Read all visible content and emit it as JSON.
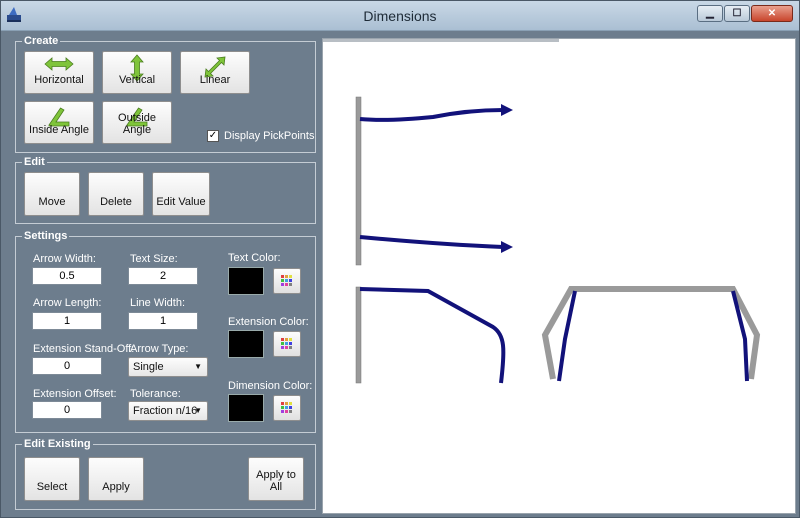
{
  "window": {
    "title": "Dimensions",
    "controls": {
      "minimize": "▁",
      "maximize": "☐",
      "close": "✕"
    }
  },
  "create": {
    "legend": "Create",
    "horizontal": "Horizontal",
    "vertical": "Vertical",
    "linear": "Linear",
    "inside_angle": "Inside Angle",
    "outside_angle": "Outside Angle",
    "display_pickpoints": "Display PickPoints",
    "display_pickpoints_checked": true
  },
  "edit": {
    "legend": "Edit",
    "move": "Move",
    "delete": "Delete",
    "edit_value": "Edit Value"
  },
  "settings": {
    "legend": "Settings",
    "arrow_width_label": "Arrow Width:",
    "arrow_width": "0.5",
    "text_size_label": "Text Size:",
    "text_size": "2",
    "arrow_length_label": "Arrow Length:",
    "arrow_length": "1",
    "line_width_label": "Line Width:",
    "line_width": "1",
    "standoff_label": "Extension Stand-Off:",
    "standoff": "0",
    "arrow_type_label": "Arrow Type:",
    "arrow_type": "Single",
    "offset_label": "Extension Offset:",
    "offset": "0",
    "tolerance_label": "Tolerance:",
    "tolerance": "Fraction n/16",
    "text_color_label": "Text Color:",
    "extension_color_label": "Extension Color:",
    "dimension_color_label": "Dimension Color:"
  },
  "edit_existing": {
    "legend": "Edit Existing",
    "select": "Select",
    "apply": "Apply",
    "apply_to_all": "Apply to All"
  },
  "colors": {
    "accent_green": "#7fc43a",
    "dimension_line": "#12127a",
    "extension_line": "#9a9a9a",
    "swatch": "#000000"
  }
}
